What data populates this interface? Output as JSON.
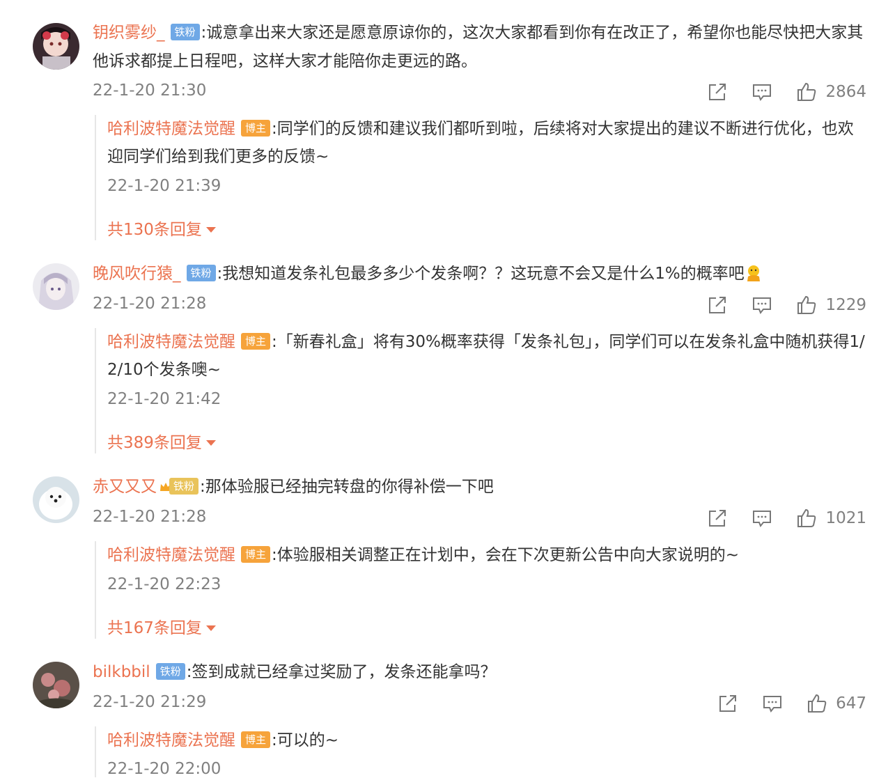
{
  "colors": {
    "username": "#eb7350",
    "text": "#333333",
    "meta": "#808080",
    "fan_badge": "#6fa8e6",
    "blogger_badge": "#f6a33b"
  },
  "comments": [
    {
      "username": "钥织雾纱_",
      "badge": "铁粉",
      "text": ":诚意拿出来大家还是愿意原谅你的，这次大家都看到你有在改正了，希望你也能尽快把大家其他诉求都提上日程吧，这样大家才能陪你走更远的路。",
      "time": "22-1-20 21:30",
      "likes": "2864",
      "reply": {
        "username": "哈利波特魔法觉醒",
        "badge": "博主",
        "text": ":同学们的反馈和建议我们都听到啦，后续将对大家提出的建议不断进行优化，也欢迎同学们给到我们更多的反馈~",
        "time": "22-1-20 21:39",
        "more": "共130条回复"
      }
    },
    {
      "username": "晚风吹行猿_",
      "badge": "铁粉",
      "text": ":我想知道发条礼包最多多少个发条啊？？这玩意不会又是什么1%的概率吧",
      "time": "22-1-20 21:28",
      "likes": "1229",
      "reply": {
        "username": "哈利波特魔法觉醒",
        "badge": "博主",
        "text": ":「新春礼盒」将有30%概率获得「发条礼包」，同学们可以在发条礼盒中随机获得1/2/10个发条噢~",
        "time": "22-1-20 21:42",
        "more": "共389条回复"
      }
    },
    {
      "username": "赤又又又",
      "badge": "铁粉",
      "text": ":那体验服已经抽完转盘的你得补偿一下吧",
      "time": "22-1-20 21:28",
      "likes": "1021",
      "reply": {
        "username": "哈利波特魔法觉醒",
        "badge": "博主",
        "text": ":体验服相关调整正在计划中，会在下次更新公告中向大家说明的~",
        "time": "22-1-20 22:23",
        "more": "共167条回复"
      }
    },
    {
      "username": "bilkbbil",
      "badge": "铁粉",
      "text": ":签到成就已经拿过奖励了，发条还能拿吗？",
      "time": "22-1-20 21:29",
      "likes": "647",
      "reply": {
        "username": "哈利波特魔法觉醒",
        "badge": "博主",
        "text": ":可以的~",
        "time": "22-1-20 22:00"
      }
    }
  ]
}
